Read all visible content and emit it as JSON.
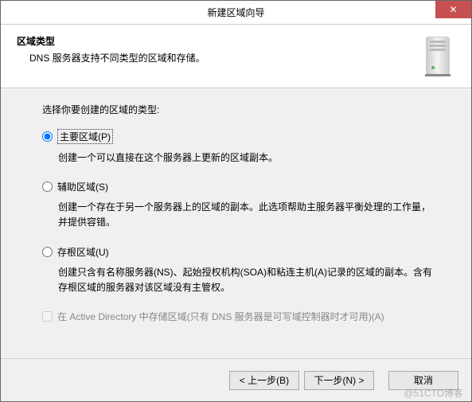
{
  "titlebar": {
    "title": "新建区域向导",
    "close": "✕"
  },
  "header": {
    "title": "区域类型",
    "subtitle": "DNS 服务器支持不同类型的区域和存储。"
  },
  "content": {
    "prompt": "选择你要创建的区域的类型:",
    "options": [
      {
        "label": "主要区域(P)",
        "desc": "创建一个可以直接在这个服务器上更新的区域副本。",
        "checked": true
      },
      {
        "label": "辅助区域(S)",
        "desc": "创建一个存在于另一个服务器上的区域的副本。此选项帮助主服务器平衡处理的工作量，并提供容错。",
        "checked": false
      },
      {
        "label": "存根区域(U)",
        "desc": "创建只含有名称服务器(NS)、起始授权机构(SOA)和粘连主机(A)记录的区域的副本。含有存根区域的服务器对该区域没有主管权。",
        "checked": false
      }
    ],
    "adcheck": {
      "label": "在 Active Directory 中存储区域(只有 DNS 服务器是可写域控制器时才可用)(A)",
      "checked": false
    }
  },
  "footer": {
    "back": "< 上一步(B)",
    "next": "下一步(N) >",
    "cancel": "取消"
  },
  "watermark": "@51CTO博客"
}
